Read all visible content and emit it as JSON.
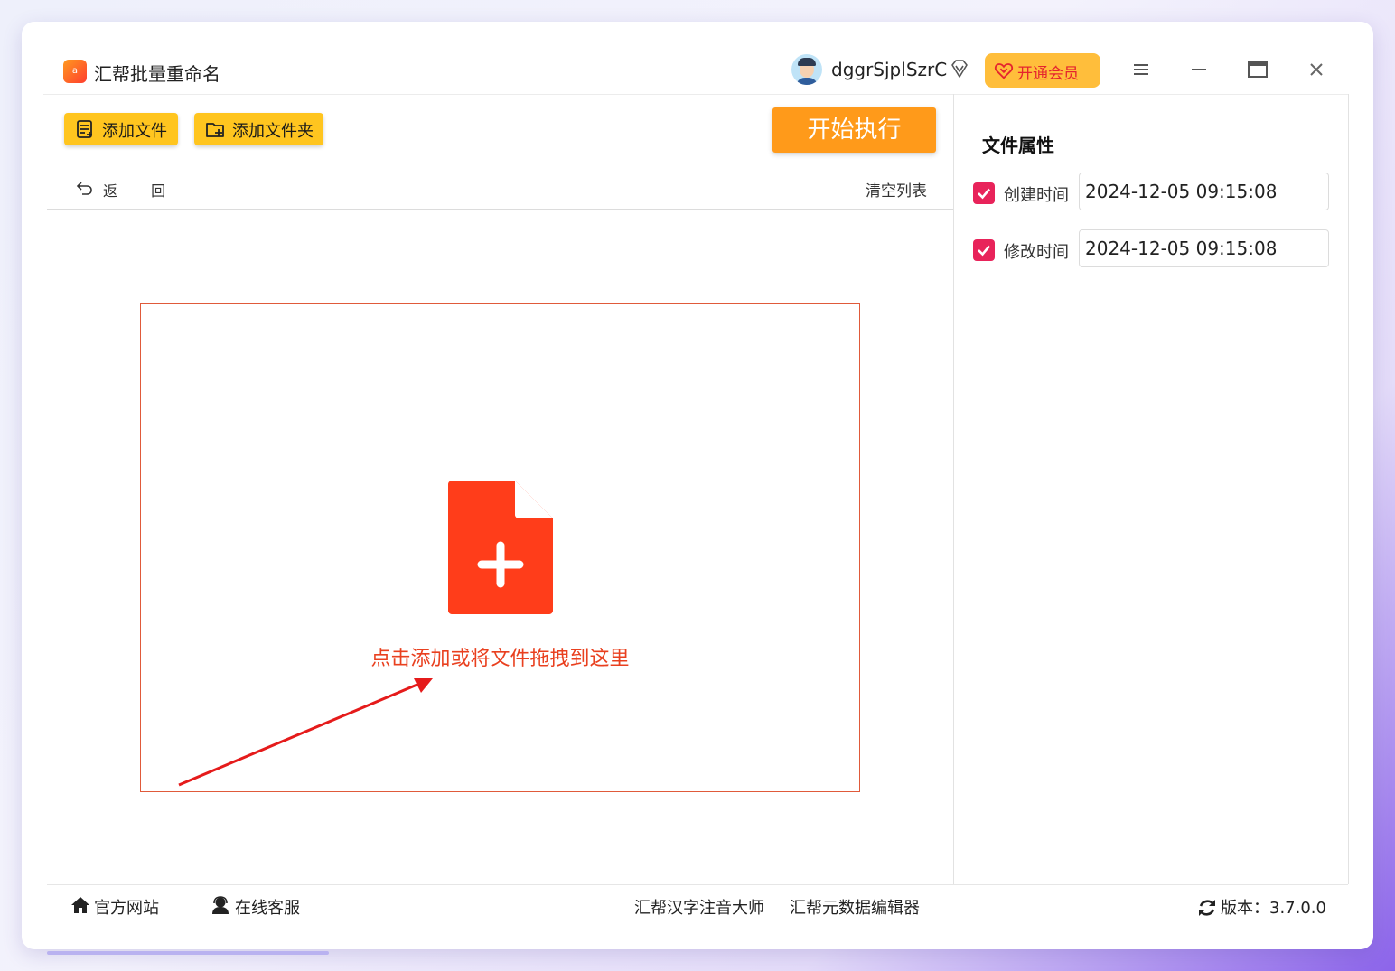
{
  "app": {
    "title": "汇帮批量重命名",
    "logo_text": "a"
  },
  "user": {
    "name": "dggrSjplSzrC",
    "vip_label": "开通会员"
  },
  "window_controls": [
    "menu-icon",
    "minimize-icon",
    "maximize-icon",
    "close-icon"
  ],
  "toolbar": {
    "add_file_label": "添加文件",
    "add_folder_label": "添加文件夹",
    "start_label": "开始执行"
  },
  "nav": {
    "back_label": "返 回",
    "clear_label": "清空列表"
  },
  "drop_zone": {
    "hint": "点击添加或将文件拖拽到这里"
  },
  "side_panel": {
    "title": "文件属性",
    "attributes": [
      {
        "label": "创建时间",
        "value": "2024-12-05 09:15:08",
        "checked": true
      },
      {
        "label": "修改时间",
        "value": "2024-12-05 09:15:08",
        "checked": true
      }
    ]
  },
  "footer": {
    "website": "官方网站",
    "support": "在线客服",
    "product1": "汇帮汉字注音大师",
    "product2": "汇帮元数据编辑器",
    "version": "版本：3.7.0.0"
  },
  "colors": {
    "accent_yellow": "#ffc51f",
    "start_orange": "#ff9a1a",
    "drop_red": "#ff3d1a",
    "checkbox_pink": "#e8235a",
    "vip_text": "#e5242e"
  }
}
